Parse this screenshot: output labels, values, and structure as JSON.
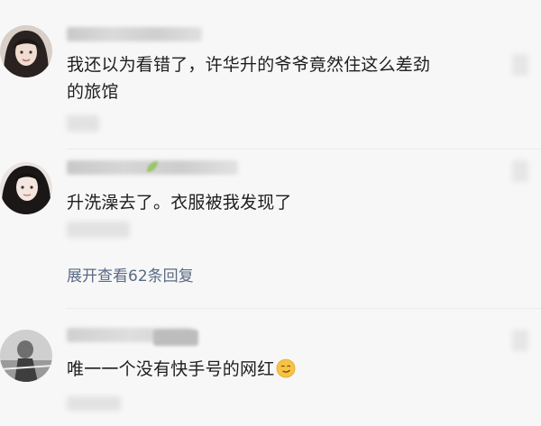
{
  "comments": [
    {
      "avatar_icon": "user-avatar-icon",
      "username": "",
      "text_line1": "我还以为看错了，许华升的爷爷竟然住这么差劲",
      "text_line2": "的旅馆"
    },
    {
      "avatar_icon": "user-avatar-icon",
      "username": "",
      "text_line1": "升洗澡去了。衣服被我发现了"
    },
    {
      "avatar_icon": "user-avatar-icon",
      "username": "",
      "text_line1": "唯一一个没有快手号的网红"
    }
  ],
  "expand_replies": "展开查看62条回复",
  "colors": {
    "background": "#f7f7f7",
    "text": "#1e1e1e",
    "link": "#5a6a85"
  }
}
